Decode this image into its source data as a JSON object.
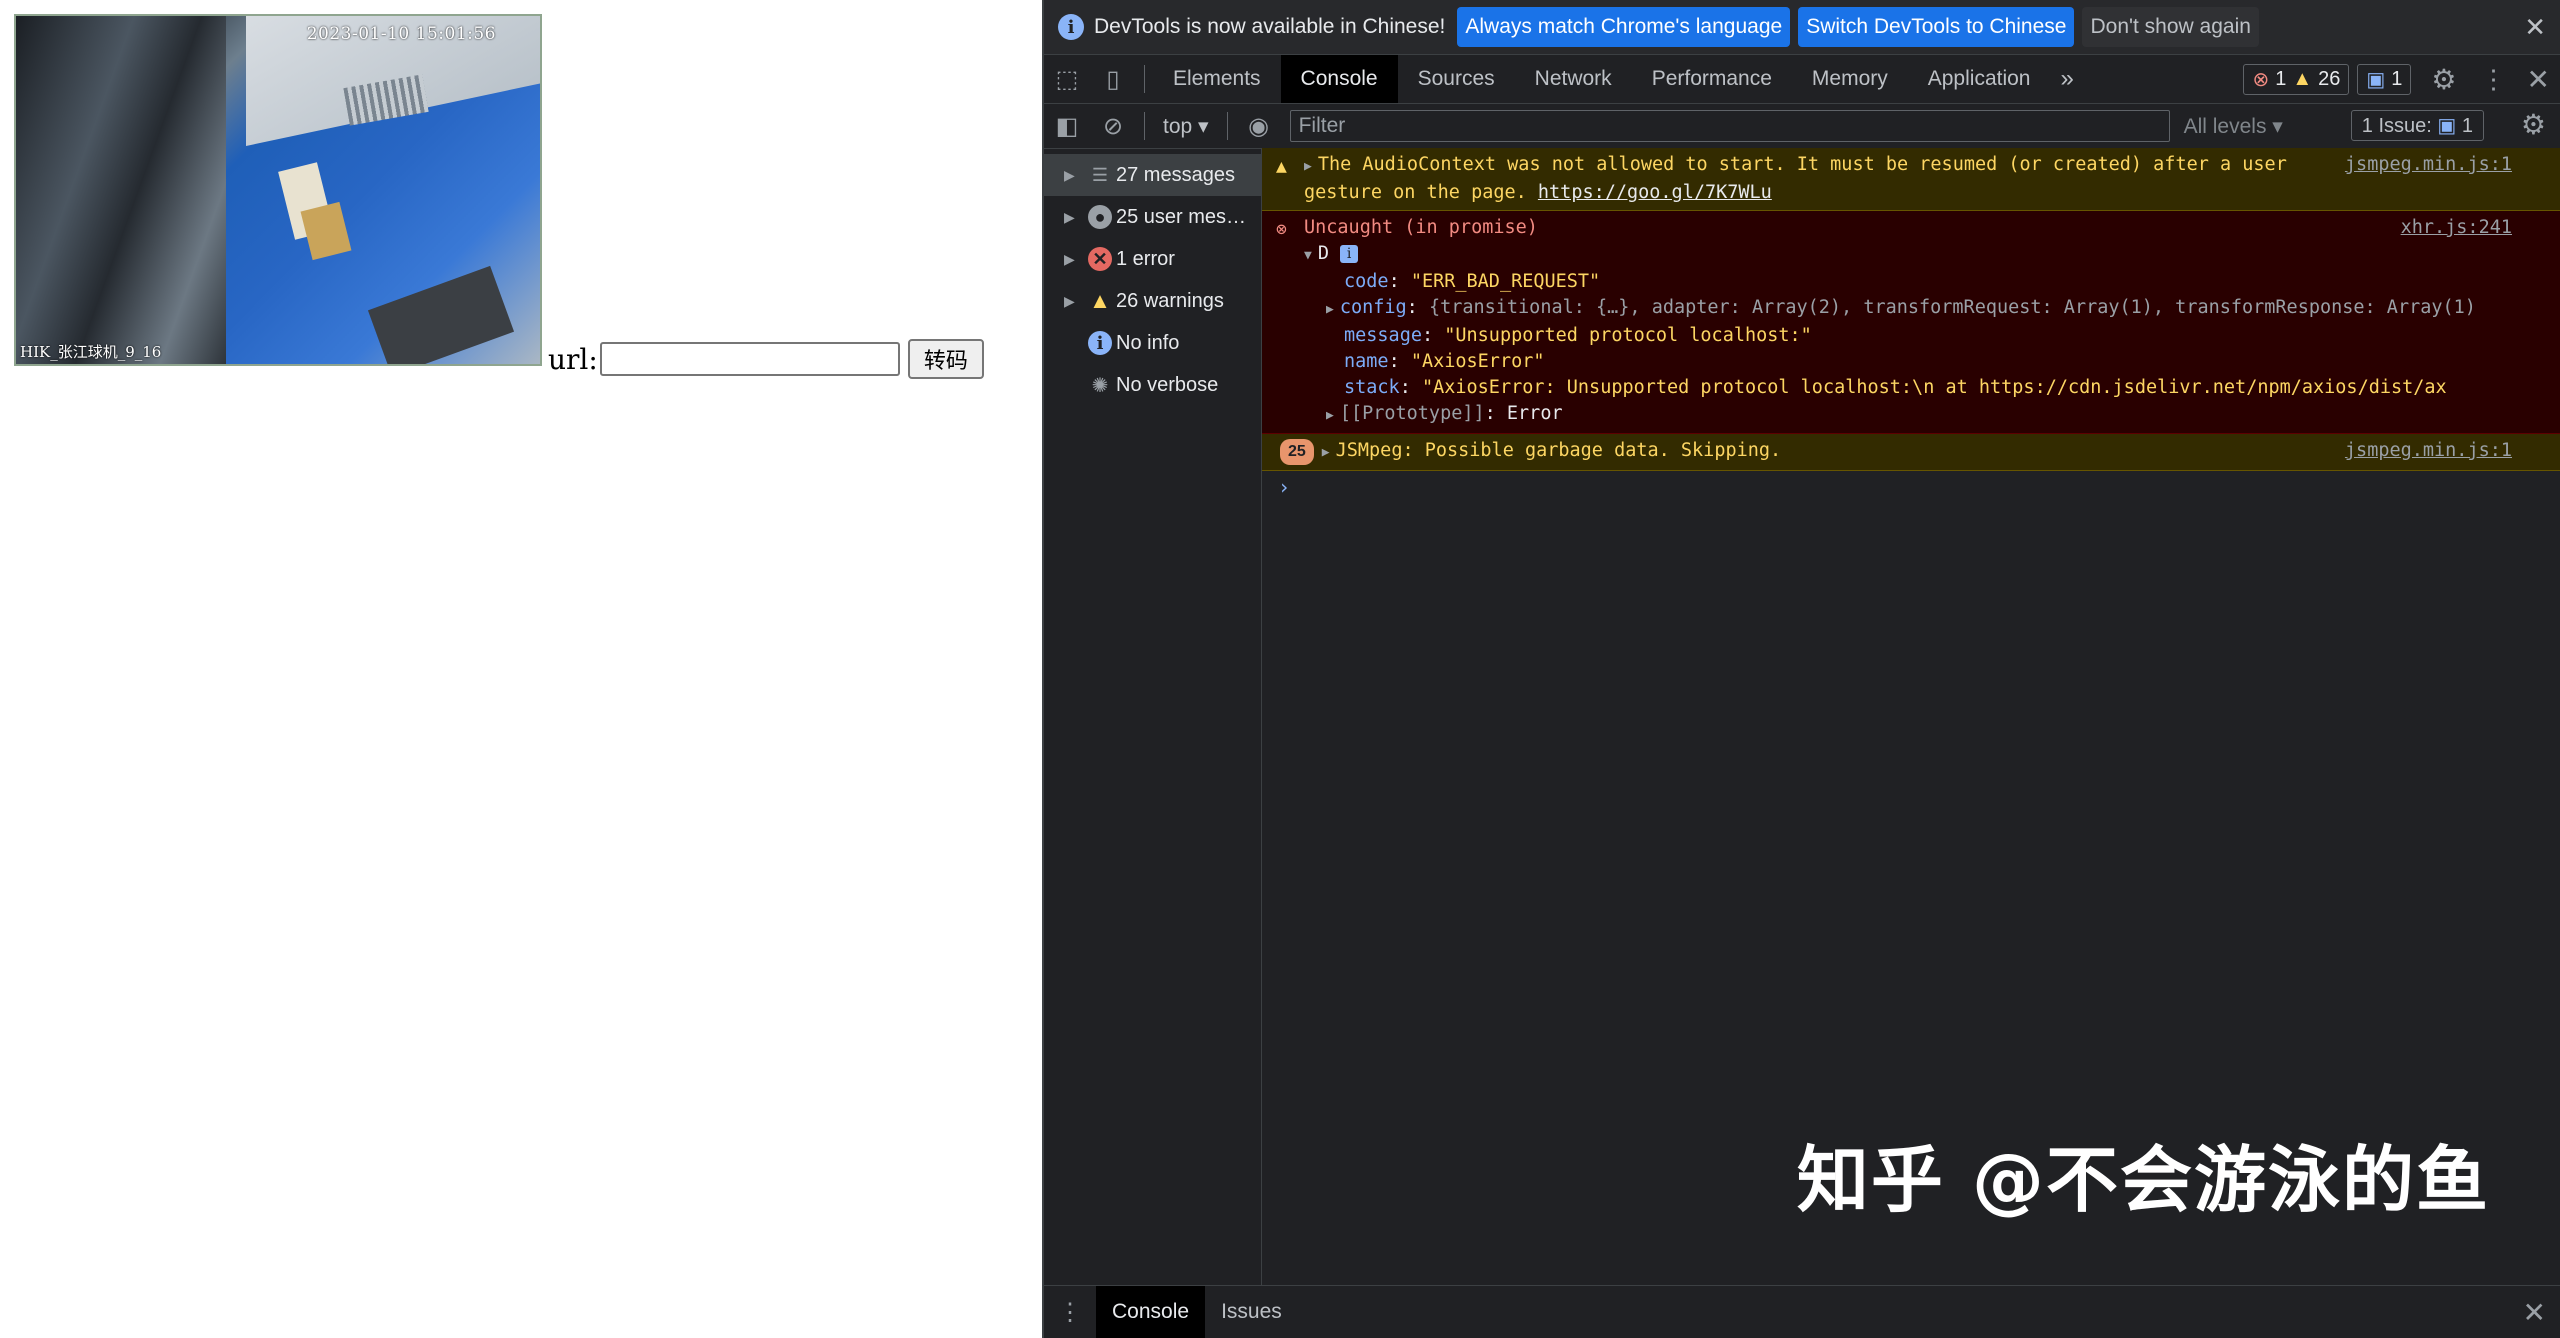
{
  "page": {
    "video": {
      "timestamp": "2023-01-10 15:01:56",
      "camera_label": "HIK_张江球机_9_16"
    },
    "url_label": "url:",
    "url_input_value": "",
    "convert_button": "转码"
  },
  "devtools": {
    "infobar": {
      "message": "DevTools is now available in Chinese!",
      "btn_match": "Always match Chrome's language",
      "btn_switch": "Switch DevTools to Chinese",
      "btn_dismiss": "Don't show again"
    },
    "tabs": [
      "Elements",
      "Console",
      "Sources",
      "Network",
      "Performance",
      "Memory",
      "Application"
    ],
    "active_tab": "Console",
    "counts": {
      "errors": "1",
      "warnings": "26",
      "messages": "1"
    },
    "toolbar": {
      "context": "top",
      "filter_placeholder": "Filter",
      "levels": "All levels",
      "issues_label": "1 Issue:",
      "issues_count": "1"
    },
    "sidebar": [
      {
        "label": "27 messages",
        "icon": "list-icon"
      },
      {
        "label": "25 user mes…",
        "icon": "user-icon"
      },
      {
        "label": "1 error",
        "icon": "error-icon"
      },
      {
        "label": "26 warnings",
        "icon": "warning-icon"
      },
      {
        "label": "No info",
        "icon": "info-icon"
      },
      {
        "label": "No verbose",
        "icon": "verbose-icon"
      }
    ],
    "console": {
      "warn1": {
        "text": "The AudioContext was not allowed to start. It must be resumed (or created) after a user",
        "text2": "gesture on the page.",
        "link": "https://goo.gl/7K7WLu",
        "source": "jsmpeg.min.js:1"
      },
      "err1": {
        "title": "Uncaught (in promise)",
        "source": "xhr.js:241",
        "obj": "D",
        "code_key": "code",
        "code_val": "\"ERR_BAD_REQUEST\"",
        "config_key": "config",
        "config_val": "{transitional: {…}, adapter: Array(2), transformRequest: Array(1), transformResponse: Array(1)",
        "message_key": "message",
        "message_val": "\"Unsupported protocol localhost:\"",
        "name_key": "name",
        "name_val": "\"AxiosError\"",
        "stack_key": "stack",
        "stack_val": "\"AxiosError: Unsupported protocol localhost:\\n    at https://cdn.jsdelivr.net/npm/axios/dist/ax",
        "proto_key": "[[Prototype]]",
        "proto_val": "Error"
      },
      "warn2": {
        "count": "25",
        "text": "JSMpeg: Possible garbage data. Skipping.",
        "source": "jsmpeg.min.js:1"
      }
    },
    "watermark": "知乎 @不会游泳的鱼",
    "drawer": {
      "console": "Console",
      "issues": "Issues"
    }
  }
}
